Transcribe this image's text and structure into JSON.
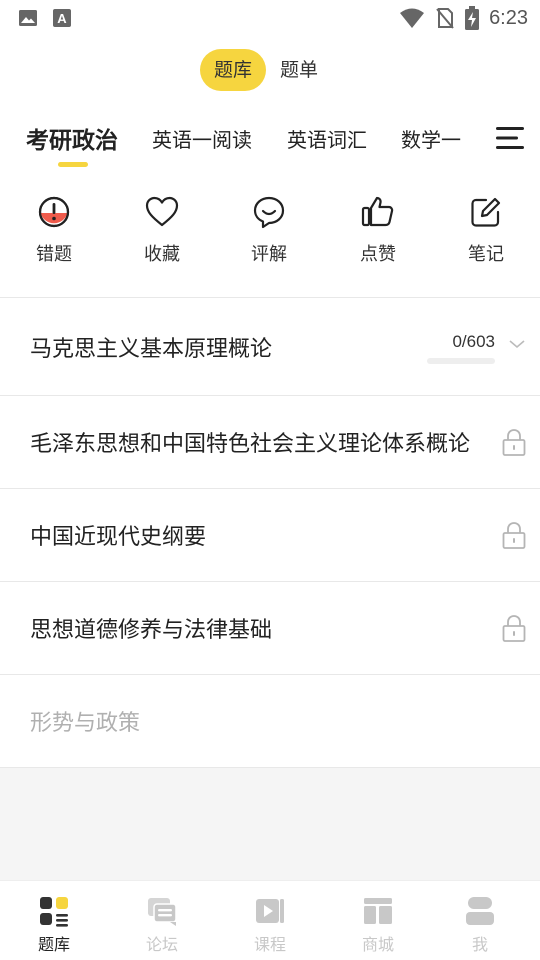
{
  "status_bar": {
    "time": "6:23",
    "icons": [
      "image-icon",
      "font-a-icon",
      "wifi-icon",
      "no-sim-icon",
      "battery-charging-icon"
    ]
  },
  "top_segment": {
    "items": [
      {
        "label": "题库",
        "active": true
      },
      {
        "label": "题单",
        "active": false
      }
    ]
  },
  "subjects": {
    "items": [
      {
        "label": "考研政治",
        "active": true
      },
      {
        "label": "英语一阅读",
        "active": false
      },
      {
        "label": "英语词汇",
        "active": false
      },
      {
        "label": "数学一",
        "active": false
      }
    ],
    "menu_icon": "hamburger-menu-icon"
  },
  "quick_actions": {
    "items": [
      {
        "label": "错题",
        "icon": "wrong-question-icon"
      },
      {
        "label": "收藏",
        "icon": "heart-icon"
      },
      {
        "label": "评解",
        "icon": "comment-icon"
      },
      {
        "label": "点赞",
        "icon": "thumbs-up-icon"
      },
      {
        "label": "笔记",
        "icon": "note-edit-icon"
      }
    ]
  },
  "chapters": {
    "items": [
      {
        "title": "马克思主义基本原理概论",
        "progress_text": "0/603",
        "done": 0,
        "total": 603,
        "locked": false,
        "expand_icon": "chevron-down-icon"
      },
      {
        "title": "毛泽东思想和中国特色社会主义理论体系概论",
        "locked": true,
        "lock_icon": "lock-icon"
      },
      {
        "title": "中国近现代史纲要",
        "locked": true,
        "lock_icon": "lock-icon"
      },
      {
        "title": "思想道德修养与法律基础",
        "locked": true,
        "lock_icon": "lock-icon"
      },
      {
        "title": "形势与政策",
        "muted": true
      }
    ]
  },
  "colors": {
    "accent": "#f6d53f",
    "wrong_red": "#ef5b4c",
    "inactive_tab": "#c8c8c8"
  },
  "tab_bar": {
    "items": [
      {
        "label": "题库",
        "icon": "question-bank-icon",
        "active": true
      },
      {
        "label": "论坛",
        "icon": "forum-icon",
        "active": false
      },
      {
        "label": "课程",
        "icon": "course-video-icon",
        "active": false
      },
      {
        "label": "商城",
        "icon": "shop-icon",
        "active": false
      },
      {
        "label": "我",
        "icon": "profile-icon",
        "active": false
      }
    ]
  }
}
